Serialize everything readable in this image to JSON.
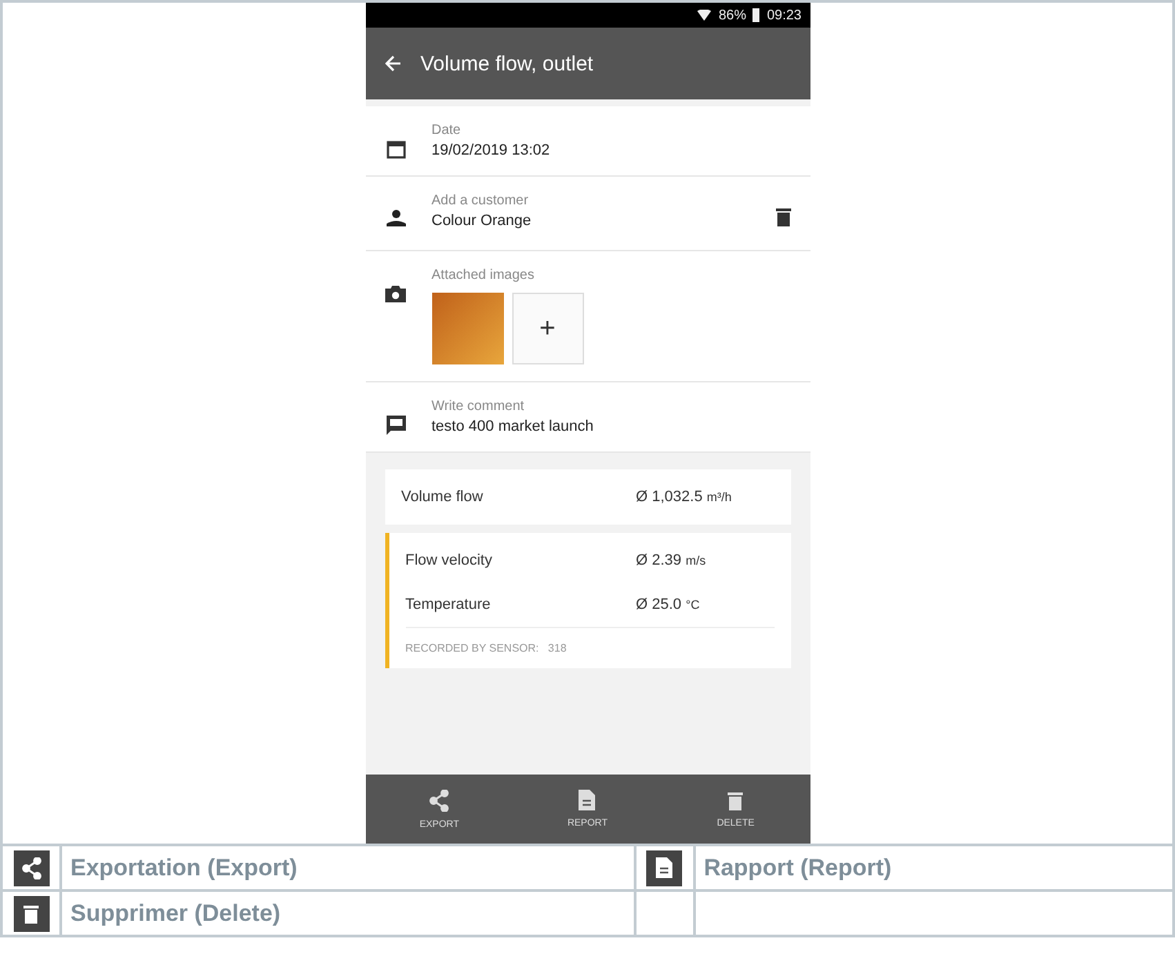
{
  "status_bar": {
    "battery": "86%",
    "time": "09:23"
  },
  "app_bar": {
    "title": "Volume flow, outlet"
  },
  "fields": [
    {
      "kind": "date",
      "label": "Date",
      "value": "19/02/2019 13:02"
    },
    {
      "kind": "customer",
      "label": "Add a customer",
      "value": "Colour Orange"
    },
    {
      "kind": "images",
      "label": "Attached images",
      "add": "+"
    },
    {
      "kind": "comment",
      "label": "Write comment",
      "value": "testo 400 market launch"
    }
  ],
  "results": [
    {
      "rows": [
        {
          "name": "Volume flow",
          "value": "Ø 1,032.5",
          "unit": "m³/h"
        }
      ]
    },
    {
      "color": "#f0b323",
      "rows": [
        {
          "name": "Flow velocity",
          "value": "Ø 2.39",
          "unit": "m/s"
        },
        {
          "name": "Temperature",
          "value": "Ø 25.0",
          "unit": "°C"
        }
      ],
      "footer": "RECORDED BY SENSOR:   318"
    }
  ],
  "bottom_bar": [
    {
      "kind": "share",
      "label": "EXPORT"
    },
    {
      "kind": "report",
      "label": "REPORT"
    },
    {
      "kind": "delete",
      "label": "DELETE"
    }
  ],
  "legend": [
    {
      "kind": "share",
      "label": "Exportation (Export)"
    },
    {
      "kind": "report",
      "label": "Rapport (Report)"
    },
    {
      "kind": "delete",
      "label": "Supprimer (Delete)"
    }
  ]
}
